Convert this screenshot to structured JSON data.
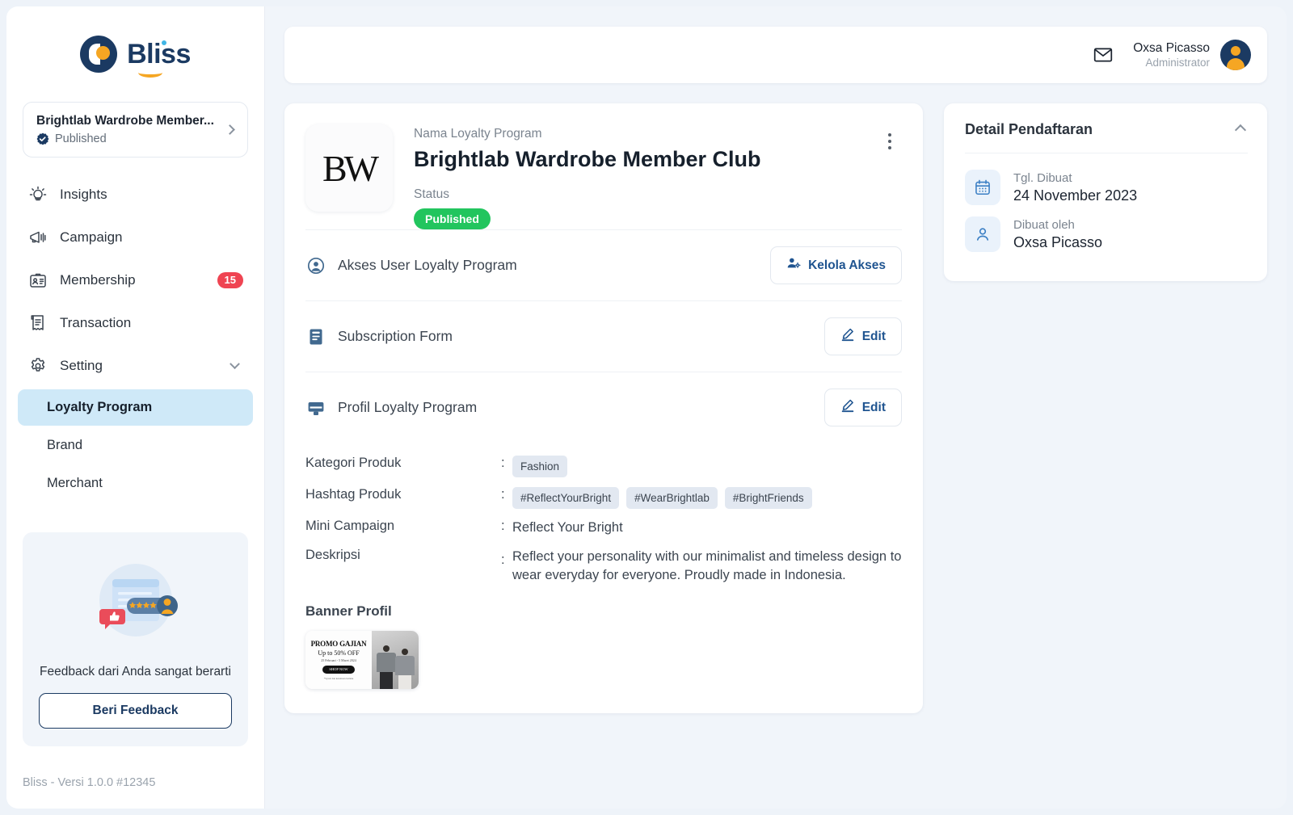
{
  "brand": {
    "name": "Bliss",
    "mark_icon": "bliss-logo-icon"
  },
  "sidebar": {
    "program_card": {
      "name": "Brightlab Wardrobe Member...",
      "status": "Published",
      "verified_icon": "verified-badge-icon",
      "chevron_icon": "chevron-right-icon"
    },
    "nav": [
      {
        "label": "Insights",
        "icon": "lightbulb-icon",
        "badge": ""
      },
      {
        "label": "Campaign",
        "icon": "megaphone-icon",
        "badge": ""
      },
      {
        "label": "Membership",
        "icon": "id-card-icon",
        "badge": "15"
      },
      {
        "label": "Transaction",
        "icon": "receipt-icon",
        "badge": ""
      },
      {
        "label": "Setting",
        "icon": "gear-icon",
        "badge": ""
      }
    ],
    "sub_items": [
      {
        "label": "Loyalty Program",
        "active": true
      },
      {
        "label": "Brand",
        "active": false
      },
      {
        "label": "Merchant",
        "active": false
      }
    ],
    "feedback": {
      "art_icon": "feedback-illustration-icon",
      "title": "Feedback dari Anda sangat berarti",
      "button": "Beri Feedback"
    },
    "version": "Bliss - Versi 1.0.0 #12345"
  },
  "topbar": {
    "mail_icon": "mail-icon",
    "user_name": "Oxsa Picasso",
    "user_role": "Administrator",
    "avatar_icon": "user-avatar-icon"
  },
  "program": {
    "logo_text": "BW",
    "name_label": "Nama Loyalty Program",
    "name": "Brightlab Wardrobe Member Club",
    "status_label": "Status",
    "status": "Published",
    "kebab_icon": "more-vertical-icon"
  },
  "sections": [
    {
      "title": "Akses User Loyalty Program",
      "icon": "user-circle-icon",
      "action": "Kelola Akses",
      "action_icon": "manage-users-icon"
    },
    {
      "title": "Subscription Form",
      "icon": "form-document-icon",
      "action": "Edit",
      "action_icon": "pencil-icon"
    },
    {
      "title": "Profil Loyalty Program",
      "icon": "monitor-icon",
      "action": "Edit",
      "action_icon": "pencil-icon"
    }
  ],
  "profile_details": {
    "kategori_key": "Kategori Produk",
    "kategori_chips": [
      "Fashion"
    ],
    "hashtag_key": "Hashtag Produk",
    "hashtag_chips": [
      "#ReflectYourBright",
      "#WearBrightlab",
      "#BrightFriends"
    ],
    "mini_campaign_key": "Mini Campaign",
    "mini_campaign_value": "Reflect Your Bright",
    "deskripsi_key": "Deskripsi",
    "deskripsi_value": "Reflect your personality with our minimalist and timeless design to wear everyday for everyone. Proudly made in Indonesia.",
    "separator": ":"
  },
  "banner": {
    "title": "Banner Profil",
    "thumb_line1": "PROMO GAJIAN",
    "thumb_line2": "Up to 50% OFF",
    "thumb_line3": "25 Februari - 5 Maret 2024",
    "thumb_button": "SHOP NOW",
    "thumb_note": "*Syarat dan ketentuan berlaku"
  },
  "side_panel": {
    "title": "Detail Pendaftaran",
    "collapse_icon": "chevron-up-icon",
    "rows": [
      {
        "key": "Tgl. Dibuat",
        "value": "24 November 2023",
        "icon": "calendar-icon"
      },
      {
        "key": "Dibuat oleh",
        "value": "Oxsa Picasso",
        "icon": "person-icon"
      }
    ]
  },
  "colors": {
    "brand_navy": "#1b3a62",
    "accent_orange": "#f5a623",
    "published_green": "#22c55e",
    "badge_red": "#ef4452",
    "active_blue": "#cfe9f8",
    "link_blue": "#1f5490",
    "page_bg": "#f1f5fa"
  }
}
